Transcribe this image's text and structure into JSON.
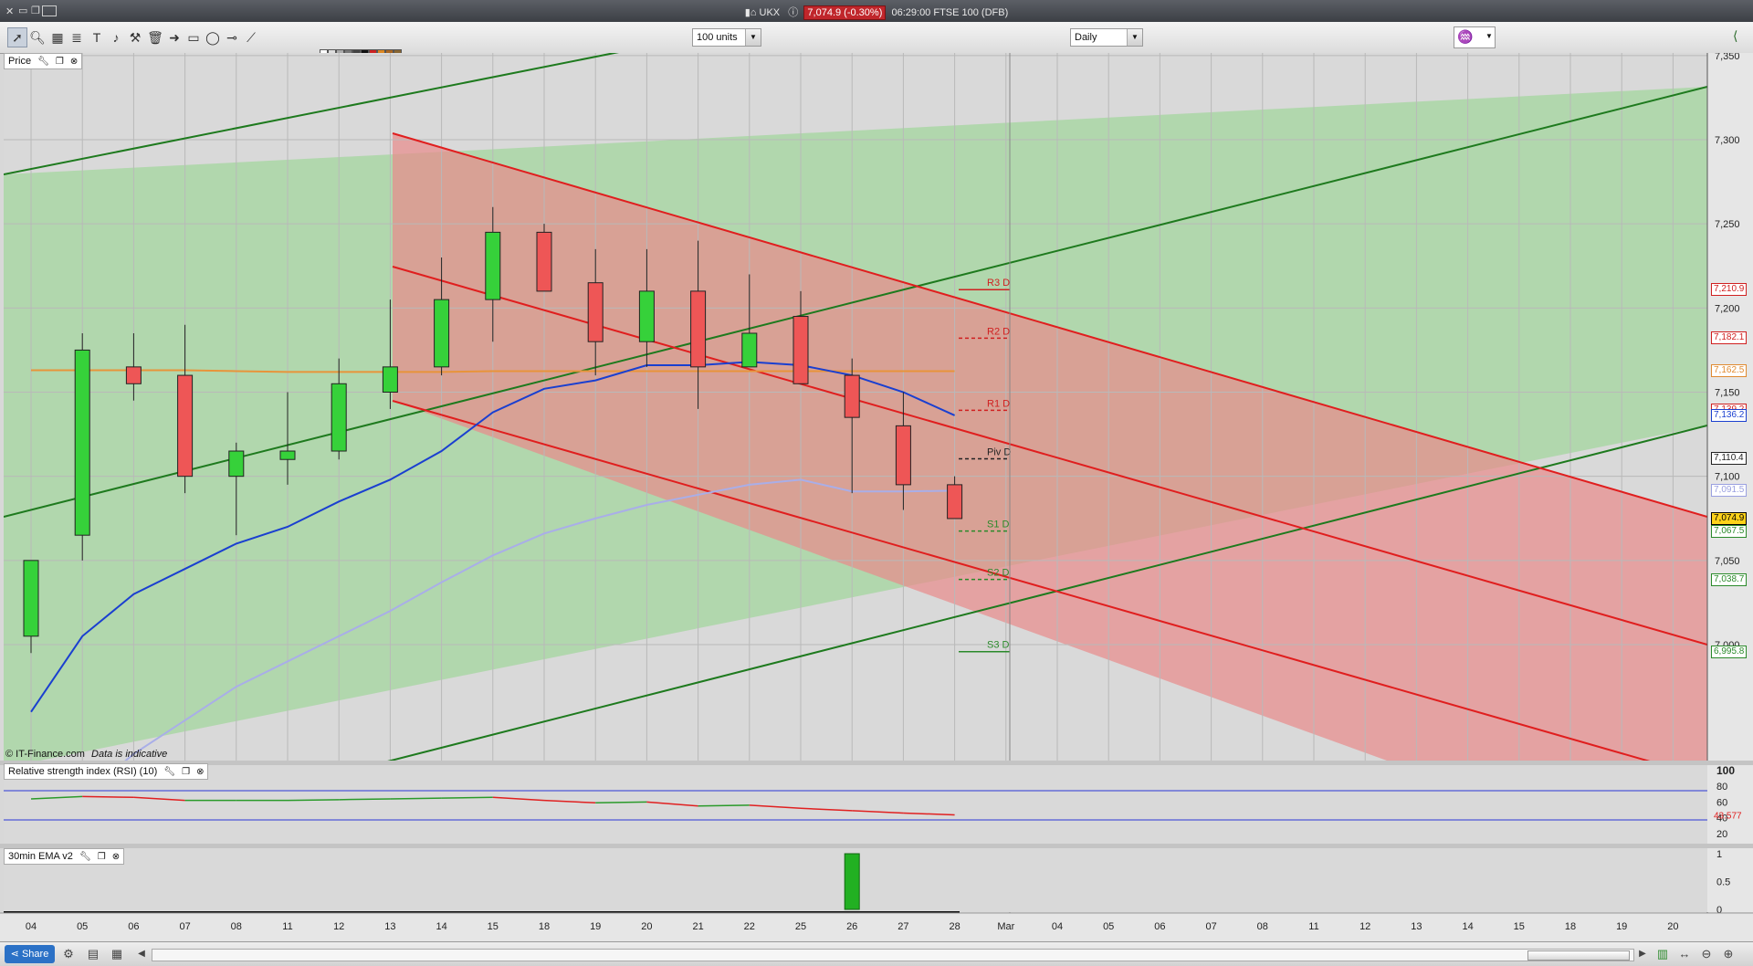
{
  "window": {
    "instrument": "UKX",
    "last_price_badge": "7,074.9 (-0.30%)",
    "time_and_name": "06:29:00 FTSE 100 (DFB)"
  },
  "toolbar": {
    "units_value": "100 units",
    "timeframe_value": "Daily",
    "tool_icons": [
      "pointer-icon",
      "zoom-icon",
      "chart-type-icon",
      "fibonacci-icon",
      "text-tool-icon",
      "alert-bell-icon",
      "measure-icon",
      "trash-icon",
      "arrow-tool-icon",
      "rectangle-icon",
      "ellipse-icon",
      "horizontal-line-icon",
      "trendline-icon"
    ],
    "palette_colors": [
      "#ffffff",
      "#dddddd",
      "#aaaaaa",
      "#777777",
      "#444444",
      "#111111",
      "#cc2222",
      "#dd8822",
      "#aa6622",
      "#886633",
      "#669922",
      "#22aa22",
      "#2288dd",
      "#2233cc",
      "#6622cc",
      "#cc22cc",
      "#ee44aa",
      "#44cccc",
      "#ffee22",
      "#44ee66"
    ]
  },
  "price_panel": {
    "label": "Price",
    "copyright": "© IT-Finance.com",
    "indicative": "Data is indicative",
    "y_ticks": [
      "7,350",
      "7,300",
      "7,250",
      "7,200",
      "7,150",
      "7,100",
      "7,050",
      "7,000"
    ],
    "price_tags": [
      {
        "text": "7,210.9",
        "color": "#d02020"
      },
      {
        "text": "7,182.1",
        "color": "#d02020"
      },
      {
        "text": "7,162.5",
        "color": "#e08a30"
      },
      {
        "text": "7,139.2",
        "color": "#d02020"
      },
      {
        "text": "7,136.2",
        "color": "#1a3fd0"
      },
      {
        "text": "7,110.4",
        "color": "#222222"
      },
      {
        "text": "7,091.5",
        "color": "#9aa0e0"
      },
      {
        "text": "7,074.9",
        "color": "#000000"
      },
      {
        "text": "7,067.5",
        "color": "#2a8a2a"
      },
      {
        "text": "7,038.7",
        "color": "#2a8a2a"
      },
      {
        "text": "6,995.8",
        "color": "#2a8a2a"
      }
    ],
    "pivots": [
      {
        "label": "R3 D",
        "value": 7210.9,
        "color": "#d02020"
      },
      {
        "label": "R2 D",
        "value": 7182.1,
        "color": "#d02020"
      },
      {
        "label": "R1 D",
        "value": 7139.2,
        "color": "#d02020"
      },
      {
        "label": "Piv D",
        "value": 7110.4,
        "color": "#222222"
      },
      {
        "label": "S1 D",
        "value": 7067.5,
        "color": "#2a8a2a"
      },
      {
        "label": "S2 D",
        "value": 7038.7,
        "color": "#2a8a2a"
      },
      {
        "label": "S3 D",
        "value": 6995.8,
        "color": "#2a8a2a"
      }
    ]
  },
  "rsi_panel": {
    "label": "Relative strength index (RSI) (10)",
    "y_ticks": [
      "100",
      "80",
      "60",
      "40",
      "20"
    ],
    "value_tag": "43.577"
  },
  "ema_panel": {
    "label": "30min EMA v2",
    "y_ticks": [
      "1",
      "0.5",
      "0"
    ]
  },
  "x_axis": [
    "04",
    "05",
    "06",
    "07",
    "08",
    "11",
    "12",
    "13",
    "14",
    "15",
    "18",
    "19",
    "20",
    "21",
    "22",
    "25",
    "26",
    "27",
    "28",
    "Mar",
    "04",
    "05",
    "06",
    "07",
    "08",
    "11",
    "12",
    "13",
    "14",
    "15",
    "18",
    "19",
    "20"
  ],
  "statusbar": {
    "share_label": "Share"
  },
  "chart_data": {
    "type": "candlestick",
    "categories": [
      "04",
      "05",
      "06",
      "07",
      "08",
      "11",
      "12",
      "13",
      "14",
      "15",
      "18",
      "19",
      "20",
      "21",
      "22",
      "25",
      "26",
      "27",
      "28"
    ],
    "open": [
      7005,
      7065,
      7165,
      7160,
      7100,
      7110,
      7115,
      7150,
      7165,
      7205,
      7245,
      7215,
      7180,
      7210,
      7165,
      7195,
      7160,
      7130,
      7095
    ],
    "high": [
      7040,
      7185,
      7185,
      7190,
      7120,
      7150,
      7170,
      7205,
      7230,
      7260,
      7250,
      7235,
      7235,
      7240,
      7220,
      7210,
      7170,
      7150,
      7100
    ],
    "low": [
      6995,
      7050,
      7145,
      7090,
      7065,
      7095,
      7110,
      7140,
      7160,
      7180,
      7210,
      7160,
      7165,
      7140,
      7165,
      7155,
      7090,
      7080,
      7075
    ],
    "close": [
      7050,
      7175,
      7155,
      7100,
      7115,
      7115,
      7155,
      7165,
      7205,
      7245,
      7210,
      7180,
      7210,
      7165,
      7185,
      7155,
      7135,
      7095,
      7074.9
    ],
    "ema_fast": [
      6960,
      7005,
      7030,
      7045,
      7060,
      7070,
      7085,
      7098,
      7115,
      7138,
      7152,
      7157,
      7166,
      7166,
      7168,
      7166,
      7160,
      7150,
      7136.2
    ],
    "ema_slow": [
      6880,
      6910,
      6935,
      6955,
      6975,
      6990,
      7005,
      7020,
      7037,
      7053,
      7066,
      7075,
      7083,
      7089,
      7095,
      7098,
      7091,
      7091,
      7091.5
    ],
    "ema_long": [
      7163,
      7163,
      7163,
      7163,
      7162.5,
      7162,
      7162,
      7162,
      7162,
      7162.5,
      7162.5,
      7162.5,
      7162.5,
      7162.5,
      7162.5,
      7162.5,
      7162.5,
      7162.5,
      7162.5
    ],
    "rsi": [
      64,
      67,
      66,
      62,
      62,
      62,
      63,
      64,
      65,
      66,
      62,
      59,
      60,
      55,
      56,
      52,
      49,
      46,
      43.577
    ],
    "ema_signal": [
      0,
      0,
      0,
      0,
      0,
      0,
      0,
      0,
      0,
      0,
      0,
      0,
      0,
      0,
      0,
      0,
      1,
      0,
      0
    ],
    "ylim": [
      6955,
      7360
    ]
  }
}
